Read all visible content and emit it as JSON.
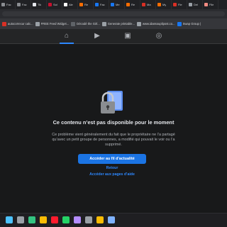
{
  "browser": {
    "tabs": [
      {
        "label": "Fac",
        "favicon_color": "#8a8d91"
      },
      {
        "label": "Fac",
        "favicon_color": "#8a8d91"
      },
      {
        "label": "Tik",
        "favicon_color": "#e4e6eb"
      },
      {
        "label": "Sol",
        "favicon_color": "#c8102e"
      },
      {
        "label": "Ale",
        "favicon_color": "#ffffff"
      },
      {
        "label": "Re",
        "favicon_color": "#ff6d00"
      },
      {
        "label": "Fac",
        "favicon_color": "#1877f2"
      },
      {
        "label": "Me",
        "favicon_color": "#1877f2"
      },
      {
        "label": "Re",
        "favicon_color": "#ff6d00"
      },
      {
        "label": "Ma",
        "favicon_color": "#d93025"
      },
      {
        "label": "My",
        "favicon_color": "#ff6d00"
      },
      {
        "label": "Fle",
        "favicon_color": "#d93025"
      },
      {
        "label": "Del",
        "favicon_color": "#9aa0a6"
      },
      {
        "label": "File",
        "favicon_color": "#f28b82"
      }
    ],
    "bookmarks": [
      {
        "label": "autocorrecur calc...",
        "favicon_color": "#d93025"
      },
      {
        "label": "FREE Feed Widget...",
        "favicon_color": "#9aa0a6"
      },
      {
        "label": "Décodé the Girl...",
        "favicon_color": "#5f6368"
      },
      {
        "label": "Generate printable...",
        "favicon_color": "#9aa0a6"
      },
      {
        "label": "www.idassouplipost.co...",
        "favicon_color": "#9aa0a6"
      },
      {
        "label": "Swap Group |",
        "favicon_color": "#1877f2"
      }
    ]
  },
  "fb_nav": {
    "icons": [
      "home-icon",
      "video-icon",
      "marketplace-icon",
      "gaming-icon"
    ],
    "active_index": 0,
    "accent": "#2d88ff"
  },
  "content": {
    "title": "Ce contenu n’est pas disponible pour le moment",
    "description": "Ce problème vient généralement du fait que le propriétaire ne l’a partagé qu’avec un petit groupe de personnes, a modifié qui pouvait le voir ou l’a supprimé.",
    "primary_button": "Accéder au fil d’actualité",
    "back_link": "Retour",
    "help_link": "Accéder aux pages d’aide",
    "button_color": "#1b74e4",
    "link_color": "#2d88ff"
  },
  "taskbar": {
    "icons": [
      {
        "name": "windows-start-icon",
        "color": "#4cc2ff"
      },
      {
        "name": "search-icon",
        "color": "#9aa0a6"
      },
      {
        "name": "edge-icon",
        "color": "#33c481"
      },
      {
        "name": "chrome-icon",
        "color": "#fbbc04"
      },
      {
        "name": "opera-icon",
        "color": "#ff1b2d"
      },
      {
        "name": "whatsapp-icon",
        "color": "#25d366"
      },
      {
        "name": "app-icon",
        "color": "#b48cff"
      },
      {
        "name": "settings-icon",
        "color": "#9aa0a6"
      },
      {
        "name": "chrome-icon",
        "color": "#fbbc04"
      },
      {
        "name": "app-icon",
        "color": "#7fb2ff"
      }
    ]
  }
}
